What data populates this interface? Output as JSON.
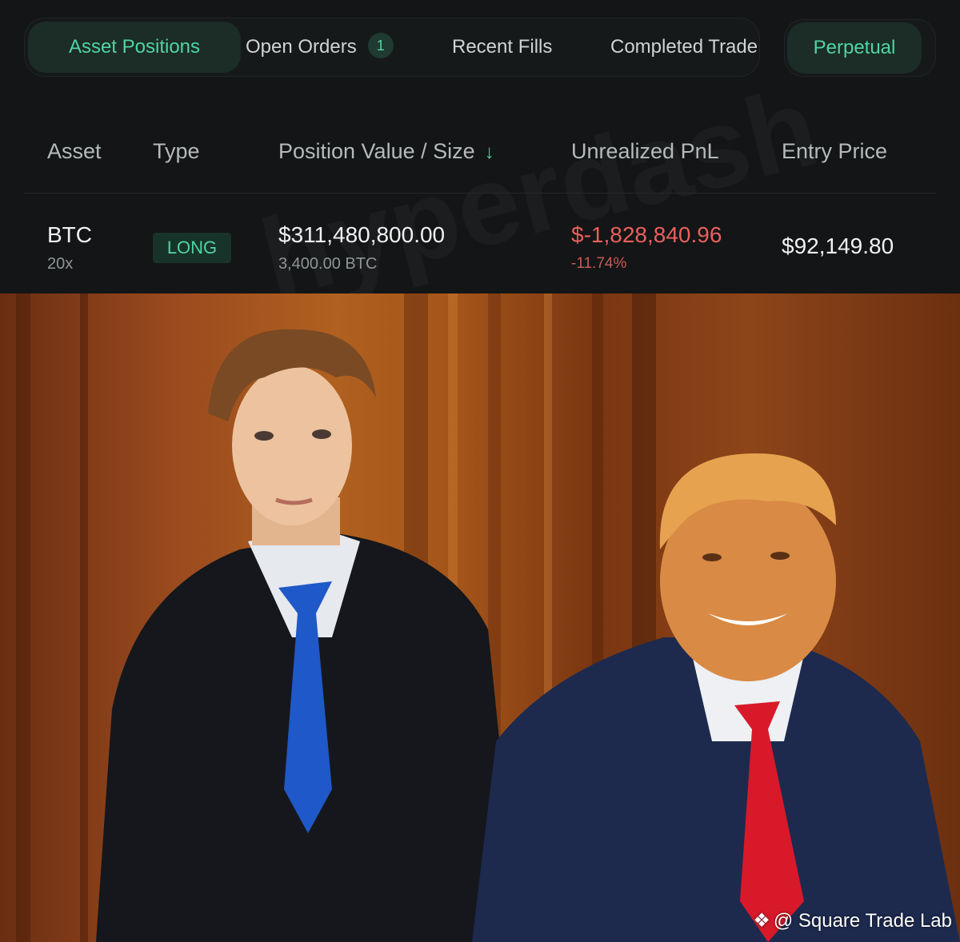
{
  "tabs": [
    {
      "label": "Asset Positions",
      "active": true
    },
    {
      "label": "Open Orders",
      "badge": "1"
    },
    {
      "label": "Recent Fills"
    },
    {
      "label": "Completed Trade"
    }
  ],
  "market_toggle": {
    "label": "Perpetual"
  },
  "columns": {
    "asset": "Asset",
    "type": "Type",
    "position": "Position Value / Size",
    "pnl": "Unrealized PnL",
    "entry": "Entry Price"
  },
  "row": {
    "asset": "BTC",
    "leverage": "20x",
    "type": "LONG",
    "position_value": "$311,480,800.00",
    "position_size": "3,400.00 BTC",
    "pnl_value": "$-1,828,840.96",
    "pnl_pct": "-11.74%",
    "entry_price": "$92,149.80"
  },
  "watermark": "hyperdash",
  "credit": "@ Square Trade Lab",
  "colors": {
    "accent": "#4fd5a2",
    "negative": "#e8605d",
    "background": "#131516"
  }
}
